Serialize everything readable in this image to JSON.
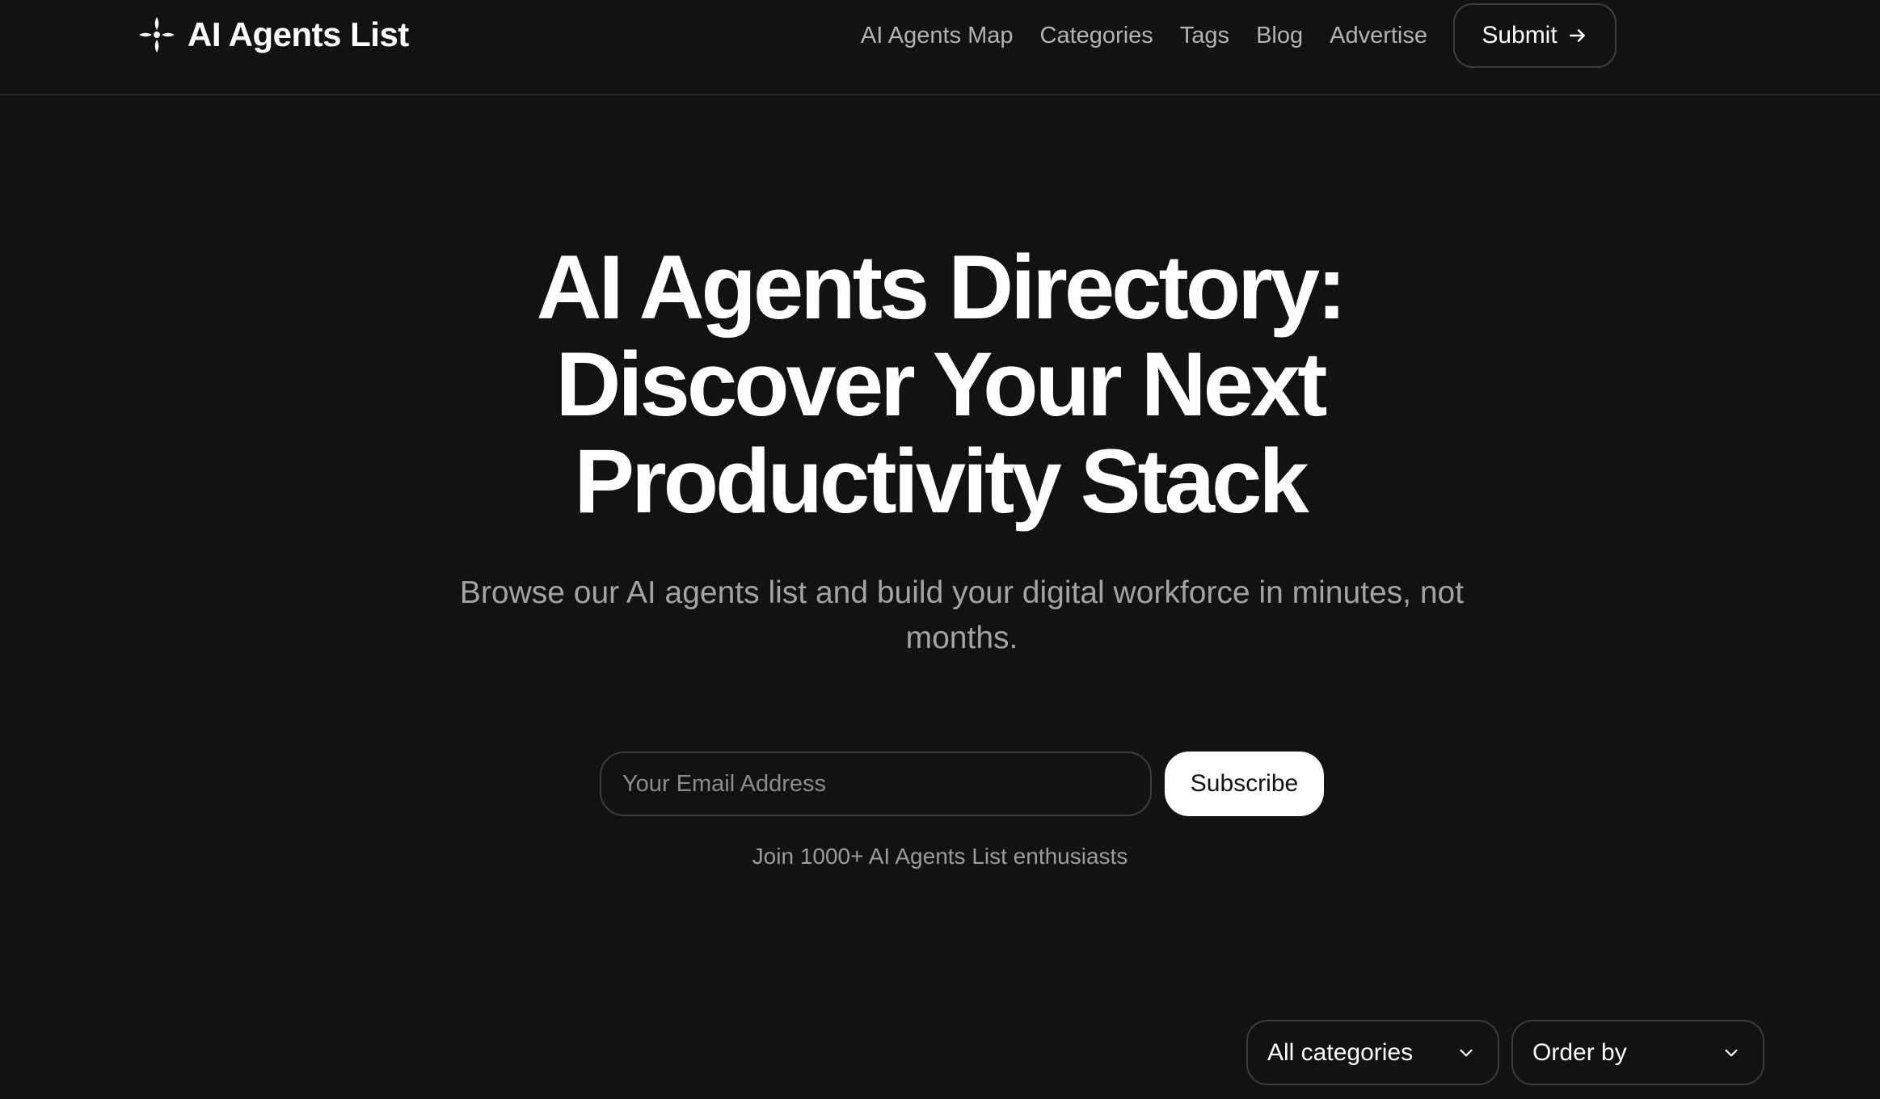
{
  "header": {
    "logo_text": "AI Agents List",
    "nav": [
      {
        "label": "AI Agents Map"
      },
      {
        "label": "Categories"
      },
      {
        "label": "Tags"
      },
      {
        "label": "Blog"
      },
      {
        "label": "Advertise"
      }
    ],
    "submit_label": "Submit"
  },
  "hero": {
    "title_lines": [
      "AI Agents Directory:",
      "Discover Your Next",
      "Productivity Stack"
    ],
    "subtitle": "Browse our AI agents list and build your digital workforce in minutes, not months."
  },
  "newsletter": {
    "email_placeholder": "Your Email Address",
    "email_value": "",
    "subscribe_label": "Subscribe",
    "join_text": "Join 1000+ AI Agents List enthusiasts"
  },
  "filters": {
    "category_selected": "All categories",
    "order_selected": "Order by"
  },
  "icons": {
    "logo": "sparkle-diamond-icon",
    "submit_arrow": "arrow-right-icon",
    "dropdown": "chevron-down-icon"
  },
  "colors": {
    "background": "#121212",
    "text": "#ffffff",
    "muted_text": "#a3a3a3",
    "border": "#3b3b3b",
    "button_bg": "#ffffff"
  }
}
